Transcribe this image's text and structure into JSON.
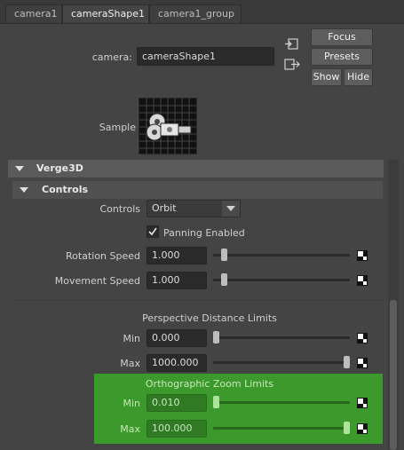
{
  "tabs": [
    "camera1",
    "cameraShape1",
    "camera1_group"
  ],
  "camera_label": "camera:",
  "camera_value": "cameraShape1",
  "buttons": {
    "focus": "Focus",
    "presets": "Presets",
    "show": "Show",
    "hide": "Hide"
  },
  "sample_label": "Sample",
  "sections": {
    "verge3d": "Verge3D",
    "controls": "Controls"
  },
  "controls": {
    "label": "Controls",
    "value": "Orbit",
    "panning_label": "Panning Enabled",
    "panning_checked": true
  },
  "rotation_speed": {
    "label": "Rotation Speed",
    "value": "1.000",
    "level": 0.06
  },
  "movement_speed": {
    "label": "Movement Speed",
    "value": "1.000",
    "level": 0.06
  },
  "perspective": {
    "title": "Perspective Distance Limits",
    "min": {
      "label": "Min",
      "value": "0.000",
      "level": 0.0
    },
    "max": {
      "label": "Max",
      "value": "1000.000",
      "level": 1.0
    }
  },
  "ortho": {
    "title": "Orthographic Zoom Limits",
    "min": {
      "label": "Min",
      "value": "0.010",
      "level": 0.0
    },
    "max": {
      "label": "Max",
      "value": "100.000",
      "level": 1.0
    }
  },
  "colors": {
    "background": "#444444",
    "highlight": "#3c9a2c"
  },
  "icons": [
    "input-connection-icon",
    "output-connection-icon",
    "camera-sample-icon",
    "map-button-icon",
    "checkmark-icon",
    "collapse-triangle-icon",
    "dropdown-arrow-icon"
  ]
}
